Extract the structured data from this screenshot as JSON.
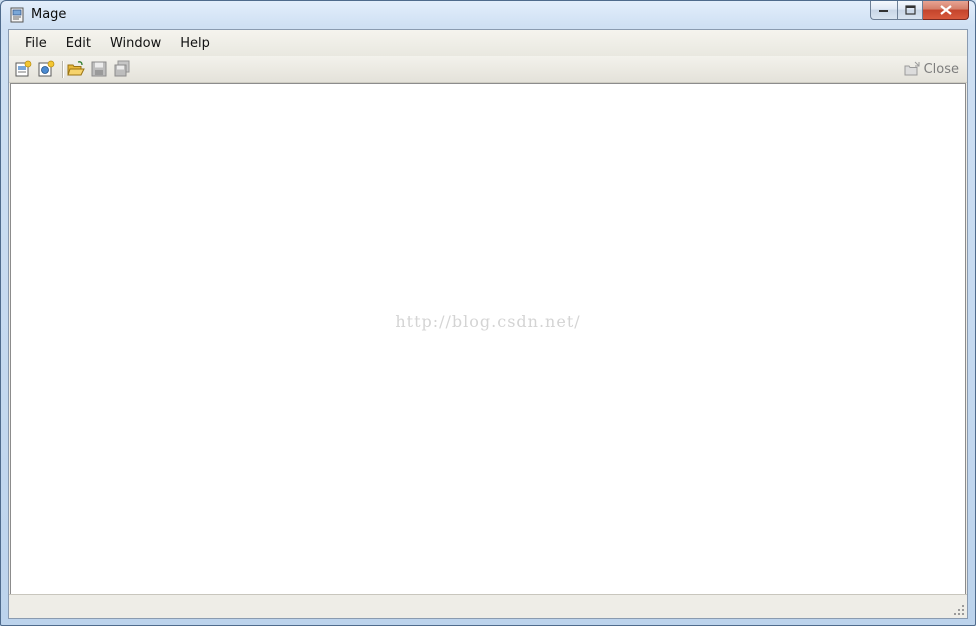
{
  "window": {
    "title": "Mage"
  },
  "menu": {
    "items": [
      "File",
      "Edit",
      "Window",
      "Help"
    ]
  },
  "toolbar": {
    "buttons": [
      {
        "icon": "new-application-icon",
        "enabled": true
      },
      {
        "icon": "new-deployment-manifest-icon",
        "enabled": true
      },
      {
        "icon": "open-folder-icon",
        "enabled": true
      },
      {
        "icon": "save-icon",
        "enabled": false
      },
      {
        "icon": "save-all-icon",
        "enabled": false
      }
    ],
    "close_label": "Close"
  },
  "document": {
    "watermark": "http://blog.csdn.net/"
  },
  "colors": {
    "close_button": "#c9452d",
    "toolbar_disabled_text": "#7d7d7d"
  }
}
